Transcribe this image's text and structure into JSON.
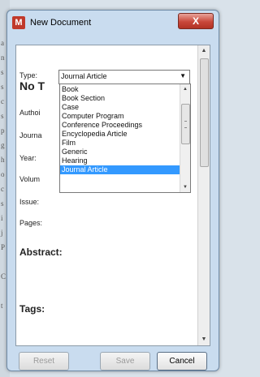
{
  "window": {
    "title": "New Document",
    "app_icon_glyph": "M",
    "close_glyph": "X"
  },
  "form": {
    "type_label": "Type:",
    "type_value": "Journal Article",
    "title_placeholder": "No T",
    "fields": {
      "author": "Authoi",
      "journal": "Journa",
      "year": "Year:",
      "volume": "Volum",
      "issue": "Issue:",
      "pages": "Pages:"
    },
    "abstract_heading": "Abstract:",
    "tags_heading": "Tags:"
  },
  "dropdown": {
    "items": [
      "Book",
      "Book Section",
      "Case",
      "Computer Program",
      "Conference Proceedings",
      "Encyclopedia Article",
      "Film",
      "Generic",
      "Hearing",
      "Journal Article"
    ],
    "selected_index": 9
  },
  "buttons": {
    "reset": "Reset",
    "save": "Save",
    "cancel": "Cancel"
  },
  "icons": {
    "app": "app-logo-icon",
    "close": "close-icon",
    "select_arrow": "chevron-down-icon",
    "scroll_up": "arrow-up-icon",
    "scroll_down": "arrow-down-icon"
  },
  "colors": {
    "selection": "#3399ff",
    "close_button": "#c9473a",
    "window_frame": "#c9dcef"
  },
  "background_text": [
    "a",
    "n",
    "s",
    "s",
    "c",
    "s",
    "p",
    "g",
    "h",
    "o",
    "c",
    "s",
    "i",
    "j",
    "P",
    "C",
    "t"
  ]
}
